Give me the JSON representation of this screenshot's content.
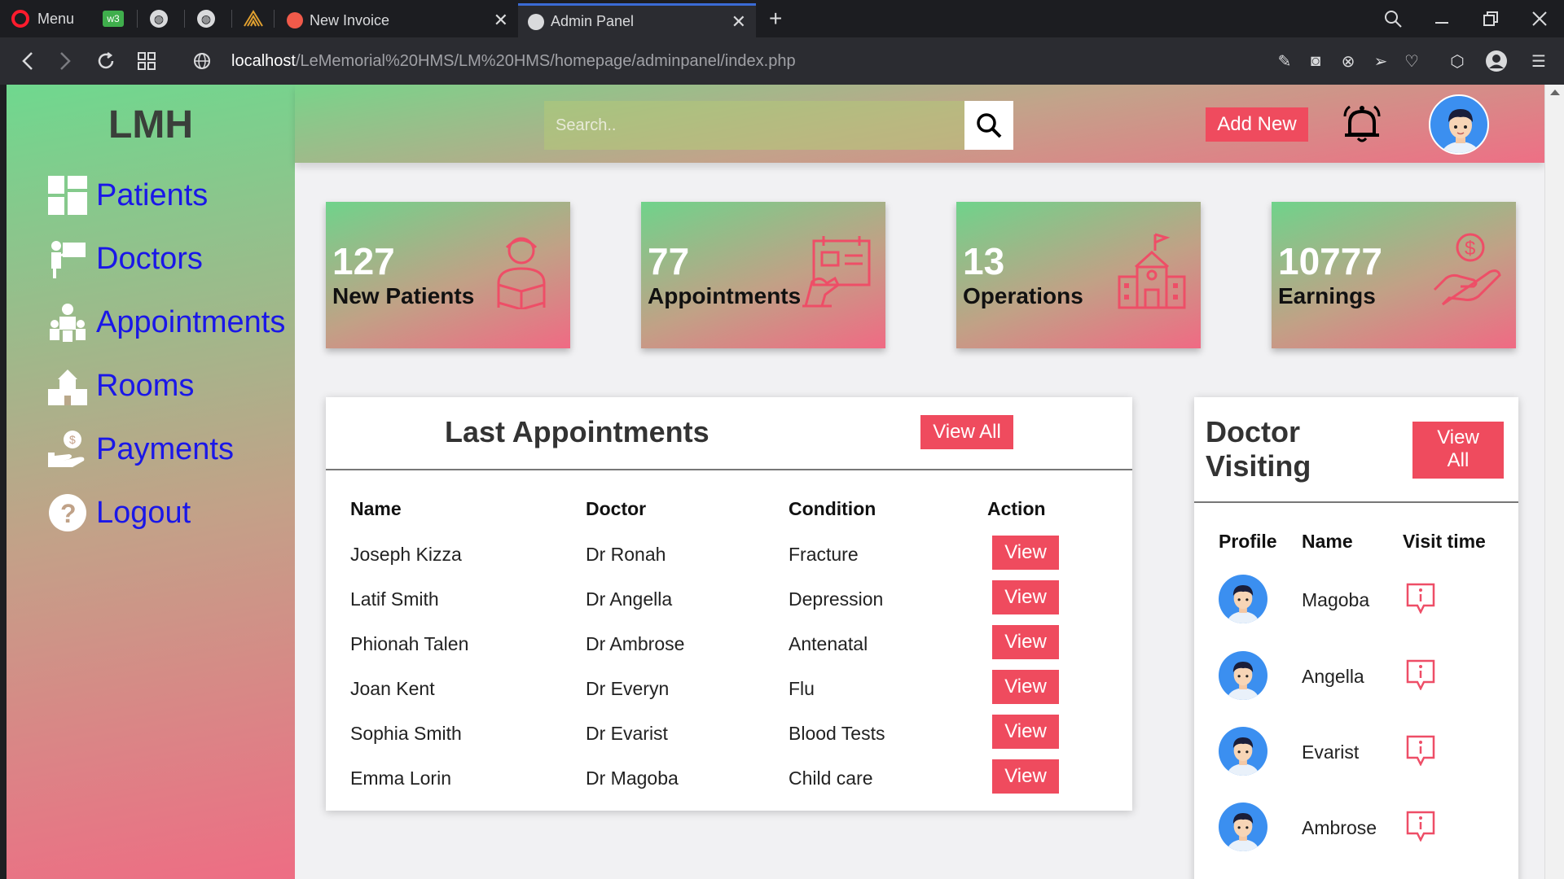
{
  "browser": {
    "menu_label": "Menu",
    "tabs": [
      {
        "title": "New Invoice"
      },
      {
        "title": "Admin Panel"
      }
    ],
    "new_tab_symbol": "+",
    "url_host": "localhost",
    "url_path": "/LeMemorial%20HMS/LM%20HMS/homepage/adminpanel/index.php"
  },
  "sidebar": {
    "brand": "LMH",
    "items": [
      {
        "label": "Patients",
        "icon": "dashboard-grid-icon"
      },
      {
        "label": "Doctors",
        "icon": "doctor-teaching-icon"
      },
      {
        "label": "Appointments",
        "icon": "appointments-people-icon"
      },
      {
        "label": "Rooms",
        "icon": "hospital-building-icon"
      },
      {
        "label": "Payments",
        "icon": "payment-hand-icon"
      },
      {
        "label": "Logout",
        "icon": "question-circle-icon"
      }
    ]
  },
  "topbar": {
    "search_placeholder": "Search..",
    "add_new_label": "Add New"
  },
  "cards": [
    {
      "value": "127",
      "label": "New Patients",
      "icon": "patient-icon"
    },
    {
      "value": "77",
      "label": "Appointments",
      "icon": "appointment-board-icon"
    },
    {
      "value": "13",
      "label": "Operations",
      "icon": "hospital-icon"
    },
    {
      "value": "10777",
      "label": "Earnings",
      "icon": "money-hand-icon"
    }
  ],
  "appointments": {
    "title": "Last Appointments",
    "view_all_label": "View All",
    "columns": [
      "Name",
      "Doctor",
      "Condition",
      "Action"
    ],
    "rows": [
      {
        "name": "Joseph Kizza",
        "doctor": "Dr Ronah",
        "condition": "Fracture",
        "action": "View"
      },
      {
        "name": "Latif Smith",
        "doctor": "Dr Angella",
        "condition": "Depression",
        "action": "View"
      },
      {
        "name": "Phionah Talen",
        "doctor": "Dr Ambrose",
        "condition": "Antenatal",
        "action": "View"
      },
      {
        "name": "Joan Kent",
        "doctor": "Dr Everyn",
        "condition": "Flu",
        "action": "View"
      },
      {
        "name": "Sophia Smith",
        "doctor": "Dr Evarist",
        "condition": "Blood Tests",
        "action": "View"
      },
      {
        "name": "Emma Lorin",
        "doctor": "Dr Magoba",
        "condition": "Child care",
        "action": "View"
      }
    ]
  },
  "doctor_visiting": {
    "title_line1": "Doctor",
    "title_line2": "Visiting",
    "view_all_line1": "View",
    "view_all_line2": "All",
    "columns": [
      "Profile",
      "Name",
      "Visit time"
    ],
    "rows": [
      {
        "name": "Magoba"
      },
      {
        "name": "Angella"
      },
      {
        "name": "Evarist"
      },
      {
        "name": "Ambrose"
      }
    ]
  },
  "colors": {
    "accent_red": "#ef4b5e",
    "link_blue": "#1a17e8",
    "gradient_green": "#6fd88e",
    "gradient_pink": "#ee6d84"
  }
}
